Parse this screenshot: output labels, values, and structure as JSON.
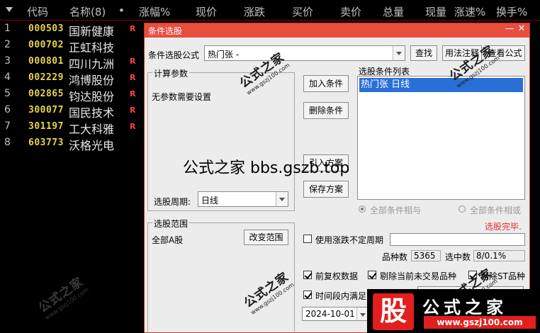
{
  "stock_list": {
    "columns": [
      "代码",
      "名称(8)",
      "•",
      "涨幅%",
      "现价",
      "涨跌",
      "买价",
      "卖价",
      "总量",
      "现量",
      "涨速%",
      "换手%"
    ],
    "rows": [
      {
        "idx": "1",
        "code": "000503",
        "name": "国新健康",
        "flag": "R"
      },
      {
        "idx": "2",
        "code": "000702",
        "name": "正虹科技",
        "flag": ""
      },
      {
        "idx": "3",
        "code": "000801",
        "name": "四川九洲",
        "flag": "R"
      },
      {
        "idx": "4",
        "code": "002229",
        "name": "鸿博股份",
        "flag": "R"
      },
      {
        "idx": "5",
        "code": "002865",
        "name": "钧达股份",
        "flag": "R"
      },
      {
        "idx": "6",
        "code": "300077",
        "name": "国民技术",
        "flag": "R"
      },
      {
        "idx": "7",
        "code": "301197",
        "name": "工大科雅",
        "flag": "R"
      },
      {
        "idx": "8",
        "code": "603773",
        "name": "沃格光电",
        "flag": ""
      }
    ]
  },
  "dialog": {
    "title": "条件选股",
    "minimize": "—",
    "close": "✕",
    "formula_label": "条件选股公式",
    "formula_value": "热门张  -",
    "query_button": "查找",
    "usage_button": "用法注释",
    "view_formula_button": "查看公式",
    "calc_params": {
      "title": "计算参数",
      "note": "无参数需要设置",
      "period_label": "选股周期:",
      "period_value": "日线"
    },
    "add_condition": "加入条件",
    "delete_condition": "删除条件",
    "load_plan": "引入方案",
    "save_plan": "保存方案",
    "condition_list": {
      "title": "选股条件列表",
      "items": [
        "热门张  日线"
      ]
    },
    "and_all": "全部条件相与",
    "or_all": "全部条件相或",
    "status": "选股完毕.",
    "range": {
      "title": "选股范围",
      "value": "全部A股",
      "change_button": "改变范围"
    },
    "use_uncertain_period": "使用涨跌不定周期",
    "count_label": "品种数",
    "count_value": "5365",
    "selected_label": "选中数",
    "selected_value": "8/0.1%",
    "pre_adjust": "前复权数据",
    "exclude_not_traded": "剔除当前未交易品种",
    "exclude_st": "剔除ST品种",
    "time_range": "时间段内满足",
    "date_value": "2024-10-01"
  },
  "overlay": "公式之家 bbs.gszb.top",
  "watermark": {
    "cn": "公式之家",
    "url": "www.gszj100.com"
  },
  "logo": {
    "gu": "股",
    "brand": "公式之家",
    "site": "www.gszj100.com"
  },
  "colors": {
    "accent": "#e84d3d",
    "selection": "#2a6fd6",
    "code": "#e8d44a",
    "flag": "#ff4040"
  }
}
